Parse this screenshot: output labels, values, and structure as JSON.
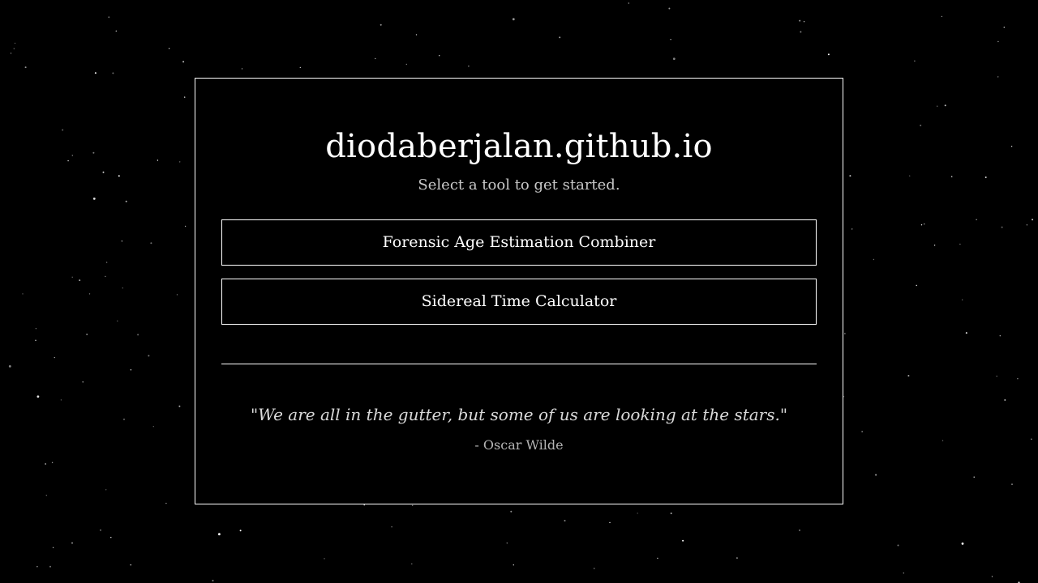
{
  "page": {
    "title": "diodaberjalan.github.io",
    "subtitle": "Select a tool to get started."
  },
  "tools": [
    {
      "label": "Forensic Age Estimation Combiner"
    },
    {
      "label": "Sidereal Time Calculator"
    }
  ],
  "quote": {
    "text": "\"We are all in the gutter, but some of us are looking at the stars.\"",
    "author": "- Oscar Wilde"
  },
  "colors": {
    "background": "#000000",
    "foreground": "#ffffff",
    "muted": "#c8c8c8"
  }
}
